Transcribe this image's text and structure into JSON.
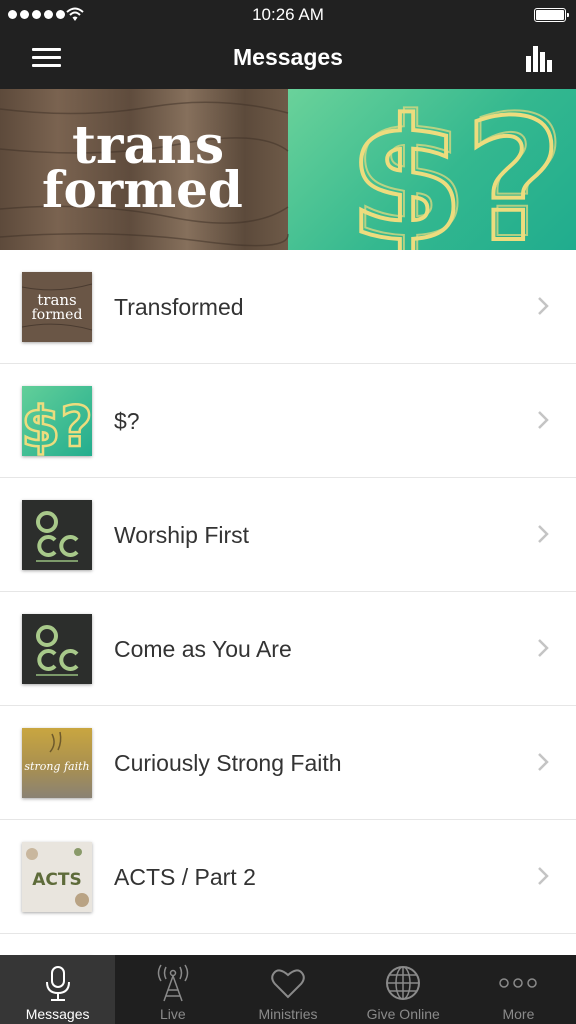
{
  "status_bar": {
    "time": "10:26 AM"
  },
  "header": {
    "title": "Messages"
  },
  "banner": {
    "left_word_top": "trans",
    "left_word_bottom": "formed",
    "right_glyphs": "$?"
  },
  "messages": [
    {
      "title": "Transformed",
      "thumbnail": "transformed"
    },
    {
      "title": "$?",
      "thumbnail": "money-question"
    },
    {
      "title": "Worship First",
      "thumbnail": "occ-logo"
    },
    {
      "title": "Come as You Are",
      "thumbnail": "occ-logo"
    },
    {
      "title": "Curiously Strong Faith",
      "thumbnail": "strong-faith"
    },
    {
      "title": "ACTS / Part 2",
      "thumbnail": "acts"
    }
  ],
  "thumb_text": {
    "transformed_top": "trans",
    "transformed_bottom": "formed",
    "money": "$?",
    "occ": "OCC",
    "strong_faith": "strong faith",
    "acts": "ACTS"
  },
  "tabs": [
    {
      "label": "Messages",
      "icon": "microphone-icon",
      "active": true
    },
    {
      "label": "Live",
      "icon": "broadcast-tower-icon",
      "active": false
    },
    {
      "label": "Ministries",
      "icon": "heart-icon",
      "active": false
    },
    {
      "label": "Give Online",
      "icon": "globe-icon",
      "active": false
    },
    {
      "label": "More",
      "icon": "more-dots-icon",
      "active": false
    }
  ],
  "colors": {
    "header_bg": "#212121",
    "tabbar_bg": "#1f1f1f",
    "active_tab_bg": "#363636",
    "banner_green": "#34b88f",
    "banner_gold": "#eddc7e"
  }
}
